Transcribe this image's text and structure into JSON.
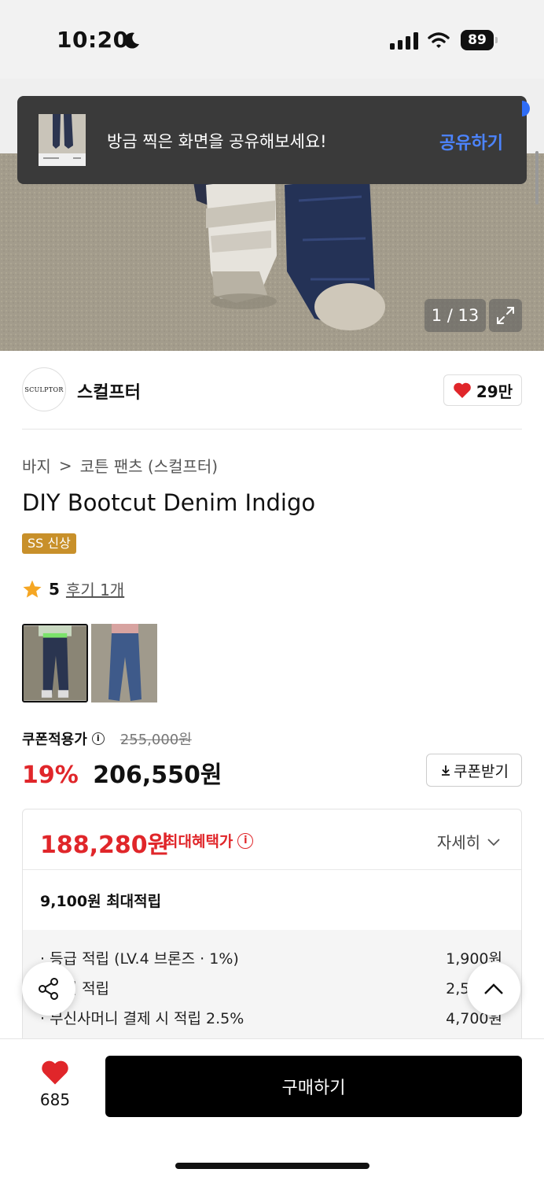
{
  "status_bar": {
    "time": "10:20",
    "battery": "89"
  },
  "toast": {
    "message": "방금 찍은 화면을 공유해보세요!",
    "action": "공유하기"
  },
  "gallery": {
    "counter": "1 / 13"
  },
  "brand": {
    "logo_text": "SCULPTOR",
    "name": "스컬프터",
    "likes": "29만"
  },
  "breadcrumb": {
    "category": "바지",
    "separator": ">",
    "subcategory": "코튼 팬츠 (스컬프터)"
  },
  "product": {
    "title": "DIY Bootcut Denim Indigo",
    "badge": "SS 신상",
    "rating": "5",
    "review_link": "후기 1개"
  },
  "pricing": {
    "coupon_label": "쿠폰적용가",
    "original_price": "255,000원",
    "discount": "19%",
    "price": "206,550원",
    "coupon_button": "쿠폰받기"
  },
  "benefits": {
    "max_price": "188,280원",
    "max_label": "최대혜택가",
    "detail_toggle": "자세히",
    "max_points": "9,100원 최대적립",
    "items": [
      {
        "label": "· 등급 적립 (LV.4 브론즈 · 1%)",
        "value": "1,900원"
      },
      {
        "label": "· 후기 적립",
        "value": "2,500원"
      },
      {
        "label": "· 무신사머니 결제 시 적립 2.5%",
        "value": "4,700원"
      }
    ]
  },
  "bottom_bar": {
    "wish_count": "685",
    "buy_label": "구매하기"
  },
  "colors": {
    "accent_red": "#e0262a",
    "link_blue": "#4c84ff",
    "badge_gold": "#c8902a",
    "star": "#f5a623"
  }
}
